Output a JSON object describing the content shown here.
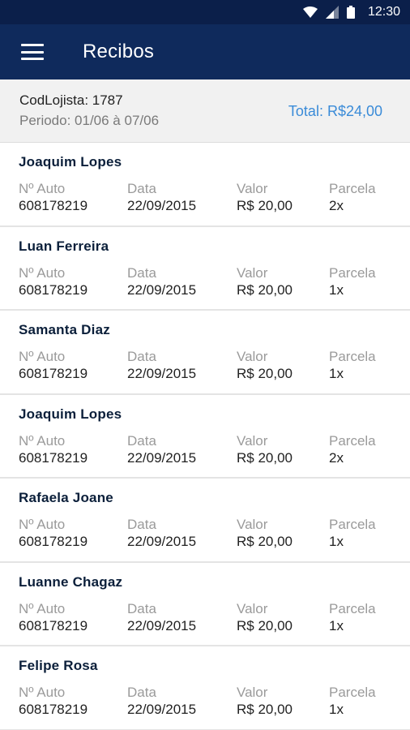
{
  "status_bar": {
    "time": "12:30",
    "icons": [
      "wifi-icon",
      "signal-icon",
      "battery-icon"
    ]
  },
  "app_bar": {
    "title": "Recibos",
    "menu_icon": "hamburger-menu-icon"
  },
  "summary": {
    "cod_lojista": "CodLojista: 1787",
    "periodo": "Periodo: 01/06 à 07/06",
    "total": "Total: R$24,00"
  },
  "colors": {
    "status_bar": "#0b1f4a",
    "app_bar": "#0f2a5c",
    "total_accent": "#3a8bd8"
  },
  "labels": {
    "auto": "Nº Auto",
    "data": "Data",
    "valor": "Valor",
    "parcela": "Parcela"
  },
  "receipts": [
    {
      "name": "Joaquim Lopes",
      "auto": "608178219",
      "data": "22/09/2015",
      "valor": "R$ 20,00",
      "parcela": "2x"
    },
    {
      "name": "Luan Ferreira",
      "auto": "608178219",
      "data": "22/09/2015",
      "valor": "R$ 20,00",
      "parcela": "1x"
    },
    {
      "name": "Samanta Diaz",
      "auto": "608178219",
      "data": "22/09/2015",
      "valor": "R$ 20,00",
      "parcela": "1x"
    },
    {
      "name": "Joaquim Lopes",
      "auto": "608178219",
      "data": "22/09/2015",
      "valor": "R$ 20,00",
      "parcela": "2x"
    },
    {
      "name": "Rafaela Joane",
      "auto": "608178219",
      "data": "22/09/2015",
      "valor": "R$ 20,00",
      "parcela": "1x"
    },
    {
      "name": "Luanne Chagaz",
      "auto": "608178219",
      "data": "22/09/2015",
      "valor": "R$ 20,00",
      "parcela": "1x"
    },
    {
      "name": "Felipe Rosa",
      "auto": "608178219",
      "data": "22/09/2015",
      "valor": "R$ 20,00",
      "parcela": "1x"
    }
  ]
}
